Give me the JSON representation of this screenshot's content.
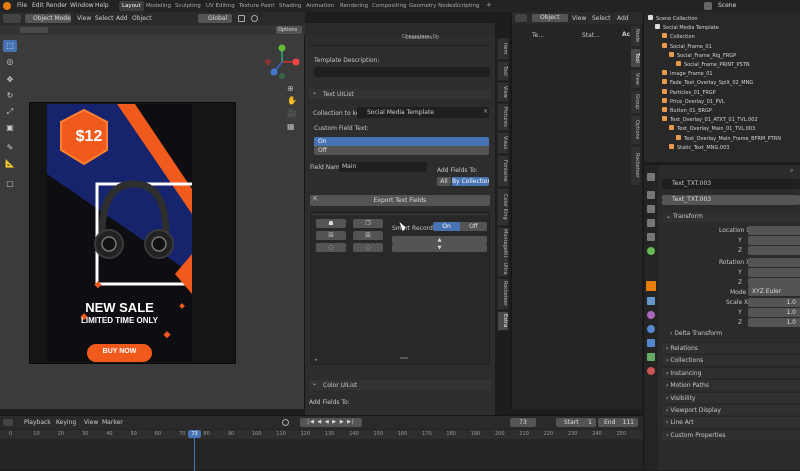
{
  "top_menu": [
    "File",
    "Edit",
    "Render",
    "Window",
    "Help"
  ],
  "workspaces": [
    "Layout",
    "Modeling",
    "Sculpting",
    "UV Editing",
    "Texture Paint",
    "Shading",
    "Animation",
    "Rendering",
    "Compositing",
    "Geometry Nodes",
    "Scripting"
  ],
  "active_workspace": "Layout",
  "scene_name": "Scene",
  "viewport_header": {
    "mode": "Object Mode",
    "menus": [
      "View",
      "Select",
      "Add",
      "Object"
    ],
    "transform": "Global",
    "options": "Options"
  },
  "artwork": {
    "price": "$12",
    "headline": "NEW SALE",
    "subline": "LIMITED TIME ONLY",
    "button": "BUY NOW"
  },
  "addon_panel": {
    "characters_label": "Characters: 0",
    "template_description_label": "Template Description:",
    "text_ui_list": "Text UIList",
    "collection_label": "Collection to keyf...",
    "collection_value": "Social Media Template",
    "custom_field_label": "Custom Field Text:",
    "custom_field_options": [
      "On",
      "Off"
    ],
    "field_name_label": "Field Name:",
    "field_name_value": "Main",
    "add_fields_to_label": "Add Fields To:",
    "add_fields_options": [
      "All",
      "By Collection"
    ],
    "export_button": "Export Text Fields",
    "smart_record_label": "Smart Recorde...",
    "smart_record_options": [
      "On",
      "Off"
    ],
    "color_ui_list": "Color UIList",
    "add_fields_to_label_2": "Add Fields To:"
  },
  "sidebar_tabs_left": [
    "Item",
    "Tool",
    "View",
    "Pictures",
    "Visus",
    "Fontaine",
    "Color King",
    "MontageKit - Ultra",
    "Rocketeer",
    "Extra"
  ],
  "node_editor": {
    "object_label": "Object",
    "menus": [
      "View",
      "Select",
      "Add"
    ],
    "breadcrumb_1": "Te...",
    "breadcrumb_2": "Stat...",
    "panel_title": "Act"
  },
  "node_side_tabs": [
    "Node",
    "Tool",
    "View",
    "Group",
    "Options",
    "Rocketeer"
  ],
  "outliner": [
    {
      "name": "Scene Collection",
      "indent": 0
    },
    {
      "name": "Social Media Template",
      "indent": 1
    },
    {
      "name": "Collection",
      "indent": 2
    },
    {
      "name": "Social_Frame_01",
      "indent": 2
    },
    {
      "name": "Social_Frame_Rig_FRGP",
      "indent": 3
    },
    {
      "name": "Social_Frame_PRINT_PSTN",
      "indent": 4
    },
    {
      "name": "Image_Frame_01",
      "indent": 2
    },
    {
      "name": "Fade_Text_Overlay_Spilt_02_MNG",
      "indent": 2
    },
    {
      "name": "Particles_01_FRGP",
      "indent": 2
    },
    {
      "name": "Price_Overlay_01_PVL",
      "indent": 2
    },
    {
      "name": "Button_01_BRGP",
      "indent": 2
    },
    {
      "name": "Text_Overlay_01_ATXT_01_TVL.002",
      "indent": 2
    },
    {
      "name": "Text_Overlay_Main_01_TVL.003",
      "indent": 3
    },
    {
      "name": "Text_Overlay_Main_Frame_BFRM_PTRN",
      "indent": 4
    },
    {
      "name": "Static_Text_MNG.003",
      "indent": 3
    }
  ],
  "properties": {
    "object_name": "Text_TXT.003",
    "data_name": "Text_TXT.003",
    "transform_label": "Transform",
    "location_label": "Location X",
    "rotation_label": "Rotation X",
    "y_label": "Y",
    "z_label": "Z",
    "mode_label": "Mode",
    "mode_value": "XYZ Euler",
    "scale_label": "Scale X",
    "scale_values": [
      "1.0",
      "1.0",
      "1.0"
    ],
    "delta_label": "Delta Transform",
    "sections": [
      "Relations",
      "Collections",
      "Instancing",
      "Motion Paths",
      "Visibility",
      "Viewport Display",
      "Line Art",
      "Custom Properties"
    ]
  },
  "timeline": {
    "menus": [
      "Playback",
      "Keying",
      "View",
      "Marker"
    ],
    "current_frame": "73",
    "start_label": "Start",
    "start_value": "1",
    "end_label": "End",
    "end_value": "111",
    "ticks": [
      "0",
      "10",
      "20",
      "30",
      "40",
      "50",
      "60",
      "70",
      "80",
      "90",
      "100",
      "110",
      "120",
      "130",
      "140",
      "150",
      "160",
      "170",
      "180",
      "190",
      "200",
      "210",
      "220",
      "230",
      "240",
      "250"
    ]
  },
  "colors": {
    "accent": "#4772b3",
    "artwork_orange": "#f15a1d",
    "artwork_navy": "#16246e"
  }
}
